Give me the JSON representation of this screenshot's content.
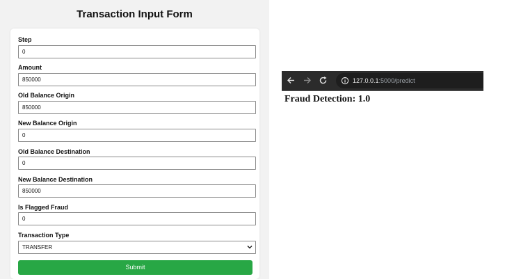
{
  "form": {
    "title": "Transaction Input Form",
    "fields": [
      {
        "label": "Step",
        "value": "0"
      },
      {
        "label": "Amount",
        "value": "850000"
      },
      {
        "label": "Old Balance Origin",
        "value": "850000"
      },
      {
        "label": "New Balance Origin",
        "value": "0"
      },
      {
        "label": "Old Balance Destination",
        "value": "0"
      },
      {
        "label": "New Balance Destination",
        "value": "850000"
      },
      {
        "label": "Is Flagged Fraud",
        "value": "0"
      }
    ],
    "transaction_type": {
      "label": "Transaction Type",
      "selected": "TRANSFER"
    },
    "submit_label": "Submit"
  },
  "browser": {
    "url_host": "127.0.0.1",
    "url_path": ":5000/predict"
  },
  "result": {
    "text": "Fraud Detection: 1.0"
  },
  "colors": {
    "submit": "#28a745",
    "left_background": "#f2f2f2",
    "browser_toolbar": "#2b2b2b"
  }
}
